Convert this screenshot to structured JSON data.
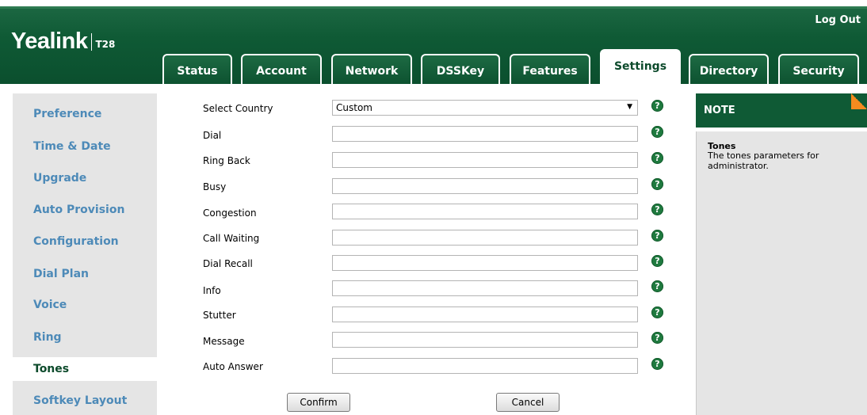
{
  "header": {
    "brand": "Yealink",
    "model": "T28",
    "logout": "Log Out"
  },
  "tabs": [
    {
      "label": "Status"
    },
    {
      "label": "Account"
    },
    {
      "label": "Network"
    },
    {
      "label": "DSSKey"
    },
    {
      "label": "Features"
    },
    {
      "label": "Settings",
      "active": true
    },
    {
      "label": "Directory"
    },
    {
      "label": "Security"
    }
  ],
  "sidebar": {
    "items": [
      {
        "label": "Preference"
      },
      {
        "label": "Time & Date"
      },
      {
        "label": "Upgrade"
      },
      {
        "label": "Auto Provision"
      },
      {
        "label": "Configuration"
      },
      {
        "label": "Dial Plan"
      },
      {
        "label": "Voice"
      },
      {
        "label": "Ring"
      },
      {
        "label": "Tones",
        "active": true
      },
      {
        "label": "Softkey Layout"
      }
    ]
  },
  "form": {
    "select_country": {
      "label": "Select Country",
      "value": "Custom"
    },
    "fields": [
      {
        "label": "Dial",
        "value": ""
      },
      {
        "label": "Ring Back",
        "value": ""
      },
      {
        "label": "Busy",
        "value": ""
      },
      {
        "label": "Congestion",
        "value": ""
      },
      {
        "label": "Call Waiting",
        "value": ""
      },
      {
        "label": "Dial Recall",
        "value": ""
      },
      {
        "label": "Info",
        "value": ""
      },
      {
        "label": "Stutter",
        "value": ""
      },
      {
        "label": "Message",
        "value": ""
      },
      {
        "label": "Auto Answer",
        "value": ""
      }
    ],
    "help_glyph": "?",
    "confirm": "Confirm",
    "cancel": "Cancel"
  },
  "note": {
    "heading": "NOTE",
    "title": "Tones",
    "text": "The tones parameters for administrator."
  },
  "colors": {
    "header_green": "#0f5a35",
    "nav_blue": "#4d8ab8",
    "help_green": "#1f7a3f",
    "note_corner": "#f48b1f"
  }
}
